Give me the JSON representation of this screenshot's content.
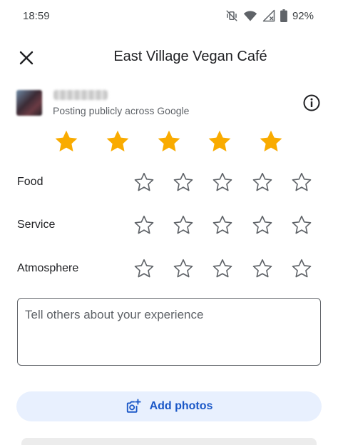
{
  "status_bar": {
    "time": "18:59",
    "battery_percent": "92%",
    "icons": [
      "vibrate-off-icon",
      "wifi-icon",
      "cell-signal-icon",
      "battery-icon"
    ]
  },
  "header": {
    "title": "East Village Vegan Café",
    "close_icon": "close-icon"
  },
  "user": {
    "posting_label": "Posting publicly across Google",
    "info_icon": "info-icon"
  },
  "overall_rating": {
    "value": 5,
    "max": 5,
    "color": "#f9ab00"
  },
  "categories": [
    {
      "label": "Food",
      "value": 0,
      "max": 5
    },
    {
      "label": "Service",
      "value": 0,
      "max": 5
    },
    {
      "label": "Atmosphere",
      "value": 0,
      "max": 5
    }
  ],
  "review": {
    "placeholder": "Tell others about your experience",
    "value": ""
  },
  "add_photos": {
    "label": "Add photos",
    "icon": "add-photo-icon",
    "color": "#1a57c7"
  }
}
